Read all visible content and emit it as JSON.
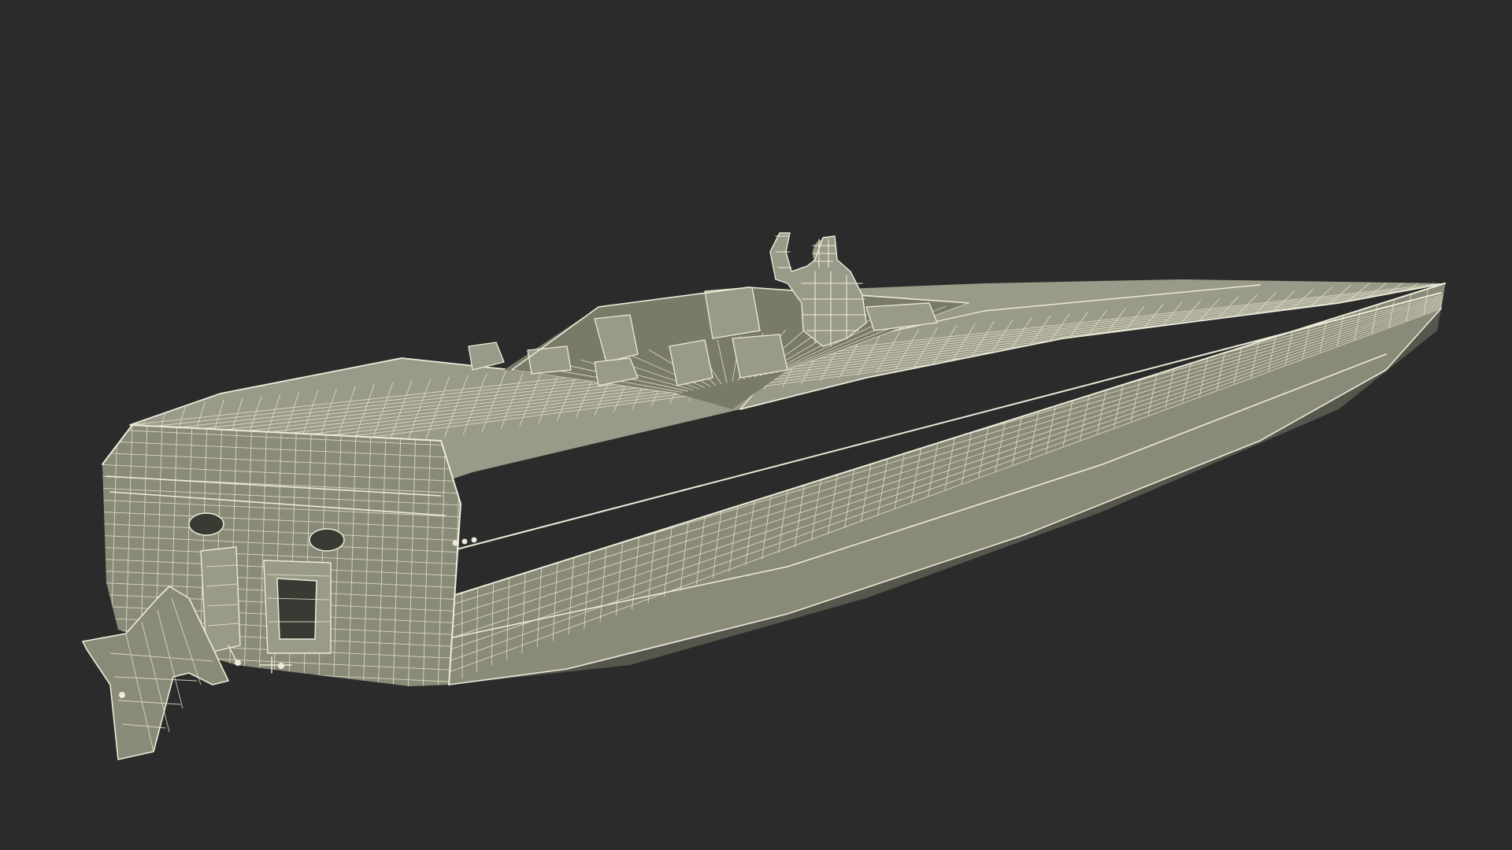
{
  "scene": {
    "subject": "speedboat-wireframe",
    "background_color": "#2b2b2b",
    "wire_color": "#ecebd8",
    "surface_color": "#8a8a78"
  }
}
